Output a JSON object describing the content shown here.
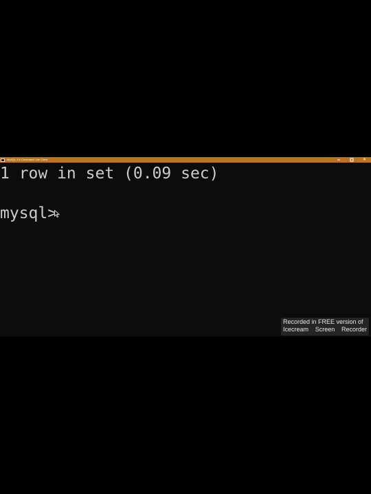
{
  "window": {
    "title": "MySQL 5.6 Command Line Client",
    "icons": {
      "app": "terminal-icon",
      "minimize": "minimize-icon",
      "maximize": "maximize-icon",
      "close": "close-icon",
      "close_glyph": "✕"
    }
  },
  "console": {
    "result_line": "1 row in set (0.09 sec)",
    "prompt": "mysql>",
    "text_color": "#cccccc",
    "background": "#0c0c0c"
  },
  "watermark": {
    "line1": "Recorded in FREE version of",
    "word1": "Icecream",
    "word2": "Screen",
    "word3": "Recorder"
  },
  "colors": {
    "titlebar": "#b9741c",
    "page_background": "#000000"
  }
}
